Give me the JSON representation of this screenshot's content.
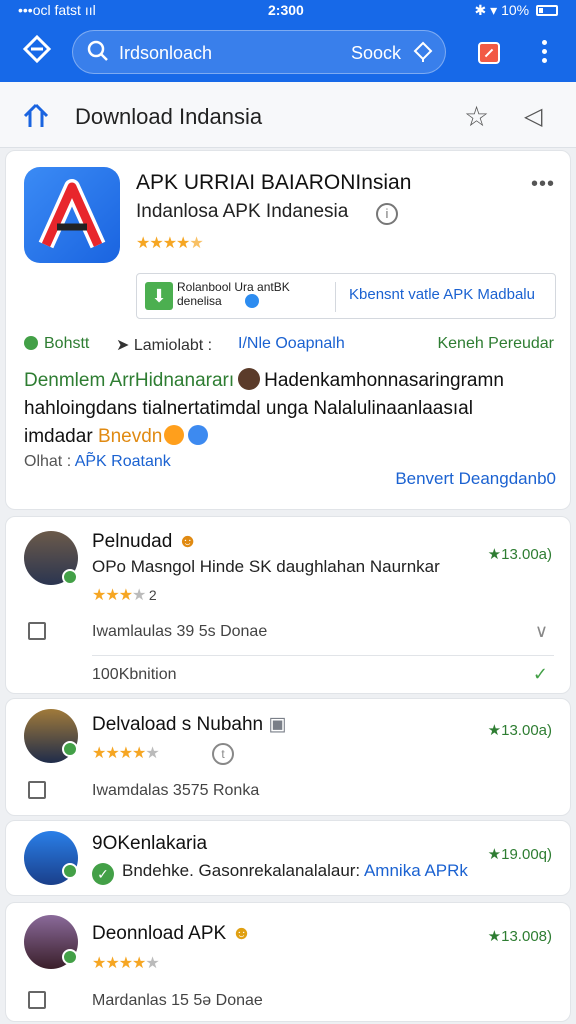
{
  "status_bar": {
    "signal": "•••ocl fatst ııl",
    "time": "2:300",
    "battery": "10%"
  },
  "app_bar": {
    "search_query": "Irdsonloach",
    "search_button": "Soock"
  },
  "page": {
    "title": "Download Indansia"
  },
  "app": {
    "name": "APK URRIAI BAIARONInsian",
    "subtitle": "Indanlosa APK Indanesia",
    "rating_stars": 4.5,
    "download_box": {
      "line1": "Rolanbool Ura antBK",
      "line2": "denelisa",
      "verify_text": "Kbensnt vatle APK Madbalu"
    },
    "meta": {
      "status": "Bohstt",
      "label": "Lamiolabt :",
      "link": "I/Nle Ooapnalh",
      "right": "Keneh Pereudar"
    },
    "description": {
      "line1_green": "Denmlem ArrHidnanararı",
      "line1_rest": "Hadenkamhonnasaringramn",
      "line2": "hahloingdans tialnertatimdal unga Nalalulinaanlaasıal",
      "line3_start": "imdadar",
      "line3_orange": "Bnevdn"
    },
    "olhat_label": "Olhat :",
    "olhat_link": "AP̃K Roatank",
    "bottom_link": "Benvert Deangdanb0"
  },
  "reviews": [
    {
      "name": "Pelnudad",
      "text": "OPo Masngol Hinde SK daughlahan Naurnkar",
      "stars": 3,
      "count_text": "2",
      "badge": "★13.00a)",
      "row1": "Iwamlaulas 39 5s Donae",
      "row2": "100Kbnition"
    },
    {
      "name": "Delvaload s Nubahn",
      "stars": 4,
      "badge": "★13.00a)",
      "row1": "Iwamdalas 3575 Ronka"
    },
    {
      "name": "9OKenlakaria",
      "text_prefix": "Bndehke. Gasonrekalanalalaur:",
      "text_link": "Amnika APRk",
      "badge": "★19.00q)"
    },
    {
      "name": "Deonnload APK",
      "stars": 4,
      "badge": "★13.008)",
      "row1": "Mardanlas 15 5ə Donae"
    }
  ],
  "colors": {
    "primary": "#1769e8",
    "green": "#43a047",
    "link": "#1b62d1",
    "star": "#f6a623"
  }
}
